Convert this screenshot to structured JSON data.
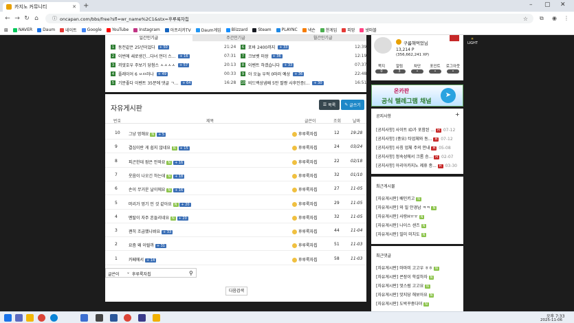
{
  "browser": {
    "tab_title": "카지노 커뮤니티",
    "url": "oncapan.com/bbs/free?sfl=wr_name%2C1&stx=후루룩자칩"
  },
  "bookmarks": [
    "NAVER",
    "Daum",
    "네이트",
    "Google",
    "YouTube",
    "Instagram",
    "아프리카TV",
    "Daum게임",
    "Blizzard",
    "Steam",
    "PLAYNC",
    "넥슨",
    "한게임",
    "피망",
    "넷마블"
  ],
  "popular": {
    "tabs": [
      "일간인기글",
      "주간인기글",
      "월간인기글"
    ],
    "left": [
      {
        "n": "1",
        "t": "동전같은 25년이었다",
        "c": "+ 50",
        "time": "21:24"
      },
      {
        "n": "2",
        "t": "이번에 새로생긴...다녀 언더 스...",
        "c": "+ 16",
        "time": "07:31"
      },
      {
        "n": "3",
        "t": "끼얏호우 주보기 당첨스 ㅅㅅㅅㅅ",
        "c": "+ 57",
        "time": "20:13"
      },
      {
        "n": "4",
        "t": "플레이어 6 ㅆㅁ러나",
        "c": "+ 49",
        "time": "00:33"
      },
      {
        "n": "5",
        "t": "기분좋다 이벤트 35분에 댓글 ㄱ...",
        "c": "+ 64",
        "time": "16:28"
      }
    ],
    "right": [
      {
        "n": "6",
        "t": "포바 2400까지",
        "c": "+ 33",
        "time": "12:39"
      },
      {
        "n": "7",
        "t": "크보벳 미쌍",
        "c": "+ 36",
        "time": "12:19"
      },
      {
        "n": "8",
        "t": "이벤트 하겠습니다",
        "c": "+ 33",
        "time": "07:37"
      },
      {
        "n": "9",
        "t": "아 오늘 우적 0마러 예상",
        "c": "+ 36",
        "time": "22:48"
      },
      {
        "n": "10",
        "t": "비드백상냄배 5만 팔짱 사후인증(...",
        "c": "+ 30",
        "time": "16:51"
      }
    ]
  },
  "board": {
    "title": "자유게시판",
    "list_btn": "목록",
    "write_btn": "글쓰기",
    "headers": {
      "no": "번호",
      "subject": "제목",
      "author": "글쓴이",
      "views": "조회",
      "date": "날짜"
    },
    "rows": [
      {
        "no": "10",
        "subject": "그냥 멍해요",
        "n": "N",
        "c": "+ 5",
        "author": "후루룩자칩",
        "views": "12",
        "date": "19:28"
      },
      {
        "no": "9",
        "subject": "결심이란 게 쉽지 않네요",
        "n": "N",
        "c": "+ 15",
        "author": "후루룩자칩",
        "views": "24",
        "date": "03/24"
      },
      {
        "no": "8",
        "subject": "피곤한데 잠은 안와요",
        "n": "N",
        "c": "+ 16",
        "author": "후루룩자칩",
        "views": "22",
        "date": "02/18"
      },
      {
        "no": "7",
        "subject": "웃음이 나오긴 하는데",
        "n": "N",
        "c": "+ 18",
        "author": "후루룩자칩",
        "views": "32",
        "date": "01/10"
      },
      {
        "no": "6",
        "subject": "손이 무거운 날이에요",
        "n": "N",
        "c": "+ 16",
        "author": "후루룩자칩",
        "views": "27",
        "date": "11-05"
      },
      {
        "no": "5",
        "subject": "머리가 멍기 인 것 같아요",
        "n": "N",
        "c": "+ 20",
        "author": "후루룩자칩",
        "views": "29",
        "date": "11-05"
      },
      {
        "no": "4",
        "subject": "멘탈이 자주 흔들리네요",
        "n": "N",
        "c": "+ 20",
        "author": "후루룩자칩",
        "views": "32",
        "date": "11-05"
      },
      {
        "no": "3",
        "subject": "괜히 조급했나봐요",
        "n": "",
        "c": "+ 33",
        "author": "후루룩자칩",
        "views": "44",
        "date": "11-04"
      },
      {
        "no": "2",
        "subject": "요즘 왜 이럴까",
        "n": "",
        "c": "+ 31",
        "author": "후루룩자칩",
        "views": "51",
        "date": "11-03"
      },
      {
        "no": "1",
        "subject": "카페에서",
        "n": "",
        "c": "+ 14",
        "author": "후루룩자칩",
        "views": "58",
        "date": "11-03"
      }
    ],
    "search_select": "글쓴이",
    "search_value": "후루룩자칩",
    "next_search": "다음검색"
  },
  "profile": {
    "name": "구름해먹었님",
    "points": "13,214 P",
    "xp": "(356,662,241 XP)",
    "stats": [
      {
        "label": "쪽지",
        "val": "0"
      },
      {
        "label": "알림",
        "val": "3"
      },
      {
        "label": "차단",
        "val": ""
      },
      {
        "label": "포인트",
        "val": ""
      },
      {
        "label": "로그아웃",
        "val": ""
      }
    ],
    "light": "LIGHT"
  },
  "banner": {
    "top": "온카판",
    "bottom": "공식 텔레그램 채널"
  },
  "notice": {
    "title": "공지사항",
    "plus": "+",
    "items": [
      {
        "t": "[공지사항] 사이트 ID가 포함된 ...",
        "d": "07-12"
      },
      {
        "t": "[공지사항] (중요) 타업체와 동...",
        "d": "07-12"
      },
      {
        "t": "[공지사항] 사칭 업체 주의 안내",
        "d": "05-08"
      },
      {
        "t": "[공지사항] 정숙성에서 크롬 승...",
        "d": "02-07"
      },
      {
        "t": "[공지사항] 아리아카지노 제휴 종...",
        "d": "03-30"
      }
    ]
  },
  "recent_posts": {
    "title": "최근게시물",
    "items": [
      "[자유게시판] 배민키고",
      "[자유게시판] 와 밀 안경남 ㅋㅋ",
      "[자유게시판] 사랑Hㅠㅠ",
      "[자유게시판] 나이스 샌즈",
      "[자유게시판] 빌미 미치도"
    ]
  },
  "recent_comments": {
    "title": "최근댓글",
    "items": [
      "[자유게시판] 마마미 고고우 ㅎㅎ",
      "[자유게시판] 콘장이 학설하자",
      "[자유게시판] 멋스럼 고고요",
      "[자유게시판] 맛지당 해보아요",
      "[자유게시판] 도박꾸중다뎌"
    ]
  },
  "taskbar": {
    "time": "오후 7:33",
    "date": "2025-11-06"
  }
}
